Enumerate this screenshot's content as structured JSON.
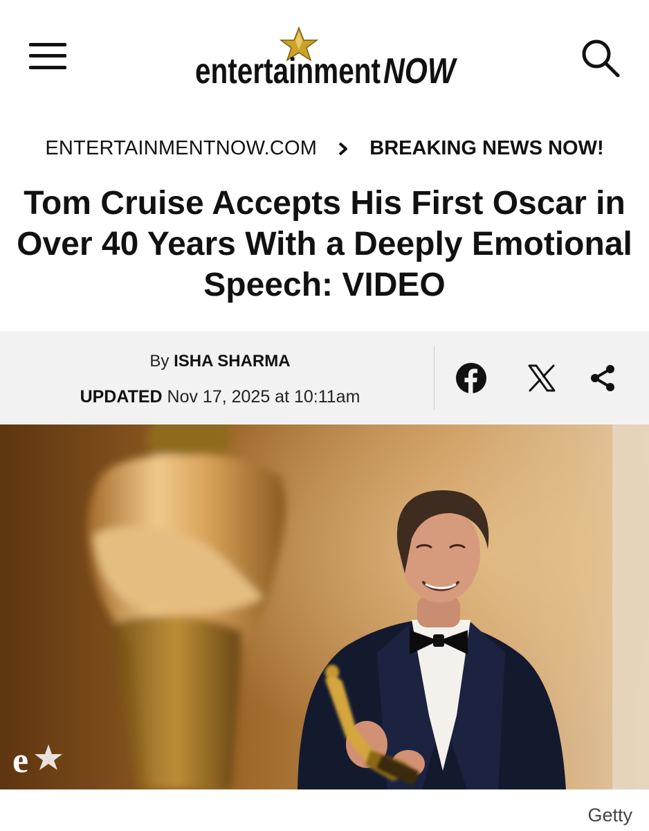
{
  "header": {
    "menu_icon": "hamburger-menu-icon",
    "logo": {
      "text_main": "entertainment",
      "text_accent": "NOW",
      "star_icon": "star-icon"
    },
    "search_icon": "search-icon"
  },
  "breadcrumb": {
    "site": "ENTERTAINMENTNOW.COM",
    "separator_icon": "chevron-right-icon",
    "section": "BREAKING NEWS NOW!"
  },
  "article": {
    "headline": "Tom Cruise Accepts His First Oscar in Over 40 Years With a Deeply Emotional Speech: VIDEO",
    "byline": {
      "prefix": "By",
      "author": "ISHA SHARMA"
    },
    "updated": {
      "label": "UPDATED",
      "datetime": "Nov 17, 2025 at 10:11am"
    },
    "share": [
      {
        "network": "facebook",
        "icon": "facebook-icon"
      },
      {
        "network": "x",
        "icon": "x-logo-icon"
      },
      {
        "network": "share",
        "icon": "share-icon"
      }
    ],
    "hero": {
      "watermark_icon": "e-star-watermark-icon",
      "credit": "Getty"
    }
  },
  "colors": {
    "text": "#111111",
    "byline_background": "#f2f2f2",
    "logo_star": "#c9a227",
    "hero_background": "#8a5a22"
  }
}
